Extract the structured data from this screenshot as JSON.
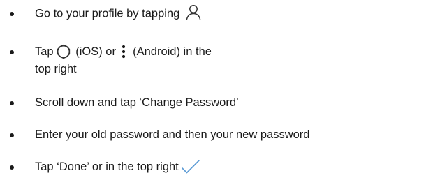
{
  "steps": [
    {
      "text": "Go to your profile by tapping",
      "icon": "profile-icon"
    },
    {
      "pre": "Tap",
      "mid_ios": "(iOS) or",
      "mid_android": "(Android) in the",
      "line2": "top right",
      "icons": [
        "gear-icon",
        "more-vert-icon"
      ]
    },
    {
      "text": "Scroll down and tap ‘Change Password’"
    },
    {
      "text": "Enter your old password and then your new password"
    },
    {
      "text": "Tap ‘Done’ or in the top right",
      "icon": "checkmark-icon"
    }
  ],
  "colors": {
    "text": "#1a1a1a",
    "icon": "#333333",
    "checkmark": "#5b9bd5"
  }
}
